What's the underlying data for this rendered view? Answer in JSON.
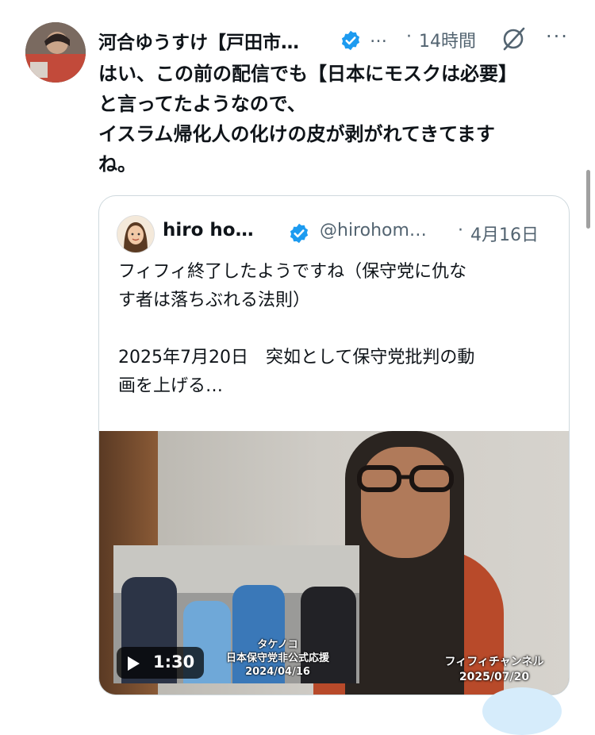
{
  "tweet": {
    "author_name": "河合ゆうすけ【戸田市…",
    "handle": "…",
    "separator": "·",
    "time": "14時間",
    "more_icon": "more-icon",
    "more_glyph": "···",
    "text": "はい、この前の配信でも【日本にモスクは必要】\nと言ってたようなので、\nイスラム帰化人の化けの皮が剥がれてきてます\nね。"
  },
  "quoted_tweet": {
    "author_name": "hiro ho…",
    "handle": "@hirohom…",
    "separator": "·",
    "date": "4月16日",
    "text": "フィフィ終了したようですね（保守党に仇な\nす者は落ちぶれる法則）\n\n2025年7月20日　突如として保守党批判の動\n画を上げる…"
  },
  "media": {
    "duration": "1:30",
    "inset_caption_line1": "タケノコ",
    "inset_caption_line2": "日本保守党非公式応援",
    "inset_caption_line3": "2024/04/16",
    "channel_caption_line1": "フィフィチャンネル",
    "channel_caption_line2": "2025/07/20"
  },
  "colors": {
    "verified_blue": "#1d9bf0",
    "secondary_text": "#536471",
    "border": "#cfd9de"
  }
}
